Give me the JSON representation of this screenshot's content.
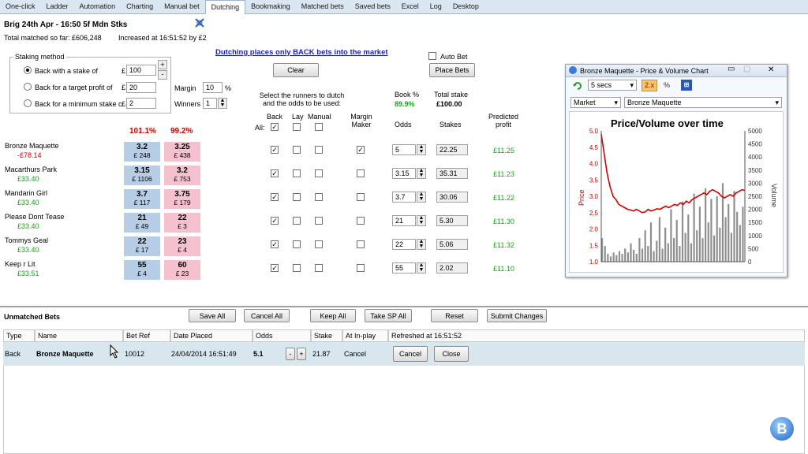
{
  "tabs": [
    "One-click",
    "Ladder",
    "Automation",
    "Charting",
    "Manual bet",
    "Dutching",
    "Bookmaking",
    "Matched bets",
    "Saved bets",
    "Excel",
    "Log",
    "Desktop"
  ],
  "market": {
    "title": "Brig 24th Apr - 16:50 5f Mdn Stks",
    "total_matched": "Total matched so far: £606,248",
    "increased": "Increased at 16:51:52 by £2"
  },
  "dutching_notice": "Dutching places only BACK bets into the market",
  "staking": {
    "legend": "Staking method",
    "options": [
      "Back with a stake of",
      "Back for a target profit of",
      "Back for a minimum stake of"
    ],
    "values": [
      "100",
      "20",
      "2"
    ],
    "currency": "£",
    "margin_label": "Margin",
    "margin_value": "10",
    "margin_unit": "%",
    "winners_label": "Winners",
    "winners_value": "1"
  },
  "buttons": {
    "clear": "Clear",
    "place_bets": "Place Bets",
    "auto_bet": "Auto Bet"
  },
  "book_pct": {
    "back": "101.1%",
    "lay": "99.2%"
  },
  "select_text": "Select the runners to dutch and the odds to be used:",
  "headers": {
    "back": "Back",
    "lay": "Lay",
    "manual": "Manual",
    "all": "All:",
    "margin_maker": "Margin Maker",
    "odds": "Odds",
    "stakes": "Stakes",
    "predicted_profit": "Predicted profit",
    "book_pct": "Book %",
    "book_value": "89.9%",
    "total_stake": "Total stake",
    "total_value": "£100.00"
  },
  "runners": [
    {
      "name": "Bronze Maquette",
      "pl": "-£78.14",
      "pl_type": "neg",
      "back": "3.2",
      "back_amt": "£ 248",
      "lay": "3.25",
      "lay_amt": "£ 438",
      "back_chk": true,
      "mm": true,
      "odds": "5",
      "stake": "22.25",
      "profit": "£11.25"
    },
    {
      "name": "Macarthurs Park",
      "pl": "£33.40",
      "pl_type": "pos",
      "back": "3.15",
      "back_amt": "£ 1106",
      "lay": "3.2",
      "lay_amt": "£ 753",
      "back_chk": true,
      "mm": false,
      "odds": "3.15",
      "stake": "35.31",
      "profit": "£11.23"
    },
    {
      "name": "Mandarin Girl",
      "pl": "£33.40",
      "pl_type": "pos",
      "back": "3.7",
      "back_amt": "£ 117",
      "lay": "3.75",
      "lay_amt": "£ 179",
      "back_chk": true,
      "mm": false,
      "odds": "3.7",
      "stake": "30.06",
      "profit": "£11.22"
    },
    {
      "name": "Please Dont Tease",
      "pl": "£33.40",
      "pl_type": "pos",
      "back": "21",
      "back_amt": "£ 49",
      "lay": "22",
      "lay_amt": "£ 3",
      "back_chk": true,
      "mm": false,
      "odds": "21",
      "stake": "5.30",
      "profit": "£11.30"
    },
    {
      "name": "Tommys Geal",
      "pl": "£33.40",
      "pl_type": "pos",
      "back": "22",
      "back_amt": "£ 17",
      "lay": "23",
      "lay_amt": "£ 4",
      "back_chk": true,
      "mm": false,
      "odds": "22",
      "stake": "5.06",
      "profit": "£11.32"
    },
    {
      "name": "Keep r Lit",
      "pl": "£33.51",
      "pl_type": "pos",
      "back": "55",
      "back_amt": "£ 4",
      "lay": "60",
      "lay_amt": "£ 23",
      "back_chk": true,
      "mm": false,
      "odds": "55",
      "stake": "2.02",
      "profit": "£11.10"
    }
  ],
  "chart_window": {
    "title": "Bronze Maquette - Price & Volume Chart",
    "interval": "5 secs",
    "zoom": "2.x",
    "pct": "%",
    "market_label": "Market",
    "runner": "Bronze Maquette"
  },
  "chart_data": {
    "type": "line",
    "title": "Price/Volume over time",
    "ylabel": "Price",
    "y2label": "Volume",
    "ylim": [
      1.0,
      5.0
    ],
    "y2lim": [
      0,
      5000
    ],
    "yticks": [
      "5.0",
      "4.5",
      "4.0",
      "3.5",
      "3.0",
      "2.5",
      "2.0",
      "1.5",
      "1.0"
    ],
    "y2ticks": [
      "5000",
      "4500",
      "4000",
      "3500",
      "3000",
      "2500",
      "2000",
      "1500",
      "1000",
      "500",
      "0"
    ],
    "price": [
      4.9,
      4.3,
      3.7,
      3.3,
      3.0,
      2.9,
      2.75,
      2.7,
      2.65,
      2.6,
      2.58,
      2.55,
      2.6,
      2.55,
      2.5,
      2.52,
      2.6,
      2.55,
      2.58,
      2.62,
      2.6,
      2.65,
      2.7,
      2.65,
      2.7,
      2.75,
      2.72,
      2.8,
      2.75,
      2.85,
      2.8,
      2.9,
      2.95,
      3.0,
      3.05,
      3.1,
      3.05,
      3.15,
      3.2,
      3.15,
      3.1,
      3.0,
      2.95,
      3.0,
      3.05,
      3.0,
      3.1,
      3.15,
      3.2,
      3.18
    ],
    "volume": [
      900,
      600,
      300,
      200,
      350,
      250,
      400,
      300,
      500,
      350,
      700,
      450,
      300,
      900,
      500,
      1200,
      600,
      1500,
      400,
      800,
      1700,
      500,
      1300,
      700,
      2000,
      900,
      1600,
      600,
      2300,
      1100,
      1800,
      700,
      2600,
      1200,
      2100,
      900,
      2800,
      1500,
      2400,
      1000,
      2500,
      1300,
      3000,
      1700,
      2200,
      1100,
      2700,
      1900,
      1400,
      2100
    ]
  },
  "unmatched": {
    "title": "Unmatched Bets",
    "buttons": [
      "Save All",
      "Cancel All",
      "Keep All",
      "Take SP All",
      "Reset",
      "Submit Changes"
    ],
    "columns": [
      "Type",
      "Name",
      "Bet Ref",
      "Date Placed",
      "Odds",
      "Stake",
      "At In-play",
      "Refreshed at 16:51:52"
    ],
    "row": {
      "type": "Back",
      "name": "Bronze Maquette",
      "ref": "10012",
      "date": "24/04/2014 16:51:49",
      "odds": "5.1",
      "stake": "21.87",
      "inplay": "Cancel",
      "cancel": "Cancel",
      "close": "Close"
    }
  }
}
